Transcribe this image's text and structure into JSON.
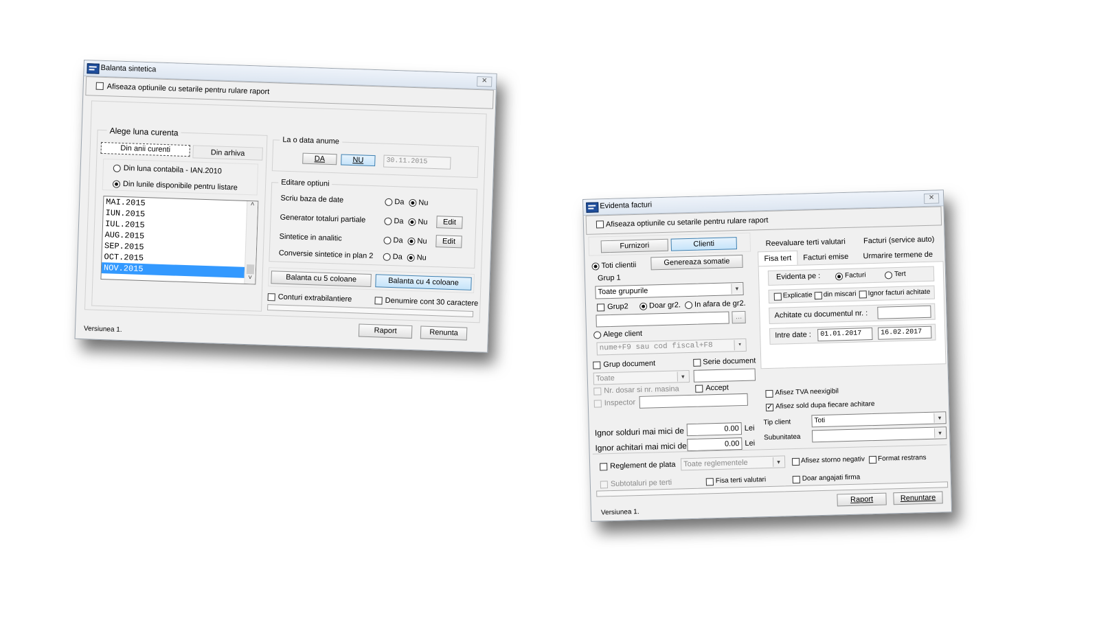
{
  "balanta": {
    "title": "Balanta sintetica",
    "show_options": "Afiseaza optiunile cu setarile pentru rulare raport",
    "alege_luna": "Alege luna curenta",
    "tab_curenti": "Din anii curenti",
    "tab_arhiva": "Din arhiva",
    "radio_luna_contabila": "Din luna contabila - IAN.2010",
    "radio_lunile": "Din lunile disponibile pentru listare",
    "months": [
      "MAI.2015",
      "IUN.2015",
      "IUL.2015",
      "AUG.2015",
      "SEP.2015",
      "OCT.2015",
      "NOV.2015"
    ],
    "selected_month": "NOV.2015",
    "la_data": "La o data anume",
    "btn_da": "DA",
    "btn_nu": "NU",
    "date_value": "30.11.2015",
    "editare": "Editare optiuni",
    "options": [
      {
        "label": "Scriu baza de date",
        "da": "Da",
        "nu": "Nu",
        "edit": ""
      },
      {
        "label": "Generator totaluri partiale",
        "da": "Da",
        "nu": "Nu",
        "edit": "Edit"
      },
      {
        "label": "Sintetice in analitic",
        "da": "Da",
        "nu": "Nu",
        "edit": "Edit"
      },
      {
        "label": "Conversie sintetice in plan 2",
        "da": "Da",
        "nu": "Nu",
        "edit": ""
      }
    ],
    "btn_5col": "Balanta cu 5 coloane",
    "btn_4col": "Balanta cu 4 coloane",
    "conturi_extra": "Conturi extrabilantiere",
    "denumire_cont": "Denumire cont 30 caractere",
    "btn_raport": "Raport",
    "btn_renunta": "Renunta",
    "version": "Versiunea 1."
  },
  "facturi": {
    "title": "Evidenta facturi",
    "show_options": "Afiseaza optiunile cu setarile pentru rulare raport",
    "btn_furnizori": "Furnizori",
    "btn_clienti": "Clienti",
    "toti_clientii": "Toti clientii",
    "genereaza_somatie": "Genereaza somatie",
    "grup1": "Grup 1",
    "grup1_value": "Toate grupurile",
    "grup2": "Grup2",
    "doar_gr2": "Doar gr2.",
    "in_afara_gr2": "In afara de gr2.",
    "ellipsis": "...",
    "alege_client": "Alege client",
    "client_placeholder": "nume+F9 sau cod fiscal+F8",
    "grup_document": "Grup document",
    "serie_document": "Serie document",
    "grup_doc_value": "Toate",
    "nr_dosar": "Nr. dosar si nr. masina",
    "accept": "Accept",
    "inspector": "Inspector",
    "ignor_solduri": "Ignor solduri mai mici de",
    "ignor_solduri_value": "0.00",
    "ignor_achitari": "Ignor achitari mai mici de",
    "ignor_achitari_value": "0.00",
    "currency": "Lei",
    "tab_reevaluare": "Reevaluare terti valutari",
    "tab_service": "Facturi (service auto)",
    "tab_fisa": "Fisa tert",
    "tab_emise": "Facturi emise",
    "tab_urmarire": "Urmarire termene de plata",
    "evidenta_pe": "Evidenta pe :",
    "radio_facturi": "Facturi",
    "radio_tert": "Tert",
    "explicatie": "Explicatie",
    "din_miscari": "din miscari",
    "ignor_achitate": "Ignor facturi achitate",
    "achitate_doc": "Achitate cu documentul nr. :",
    "intre_date": "Intre date :",
    "date_from": "01.01.2017",
    "date_to": "16.02.2017",
    "tva_neexigibil": "Afisez TVA neexigibil",
    "sold_dupa": "Afisez sold dupa fiecare achitare",
    "tip_client": "Tip client",
    "tip_client_value": "Toti",
    "subunitatea": "Subunitatea",
    "reglement": "Reglement de plata",
    "reglement_value": "Toate reglementele",
    "storno": "Afisez storno negativ",
    "format_restrans": "Format restrans",
    "subtotaluri": "Subtotaluri pe terti",
    "fisa_valutari": "Fisa terti valutari",
    "doar_angajati": "Doar angajati firma",
    "btn_raport": "Raport",
    "btn_renuntare": "Renuntare",
    "version": "Versiunea 1."
  }
}
